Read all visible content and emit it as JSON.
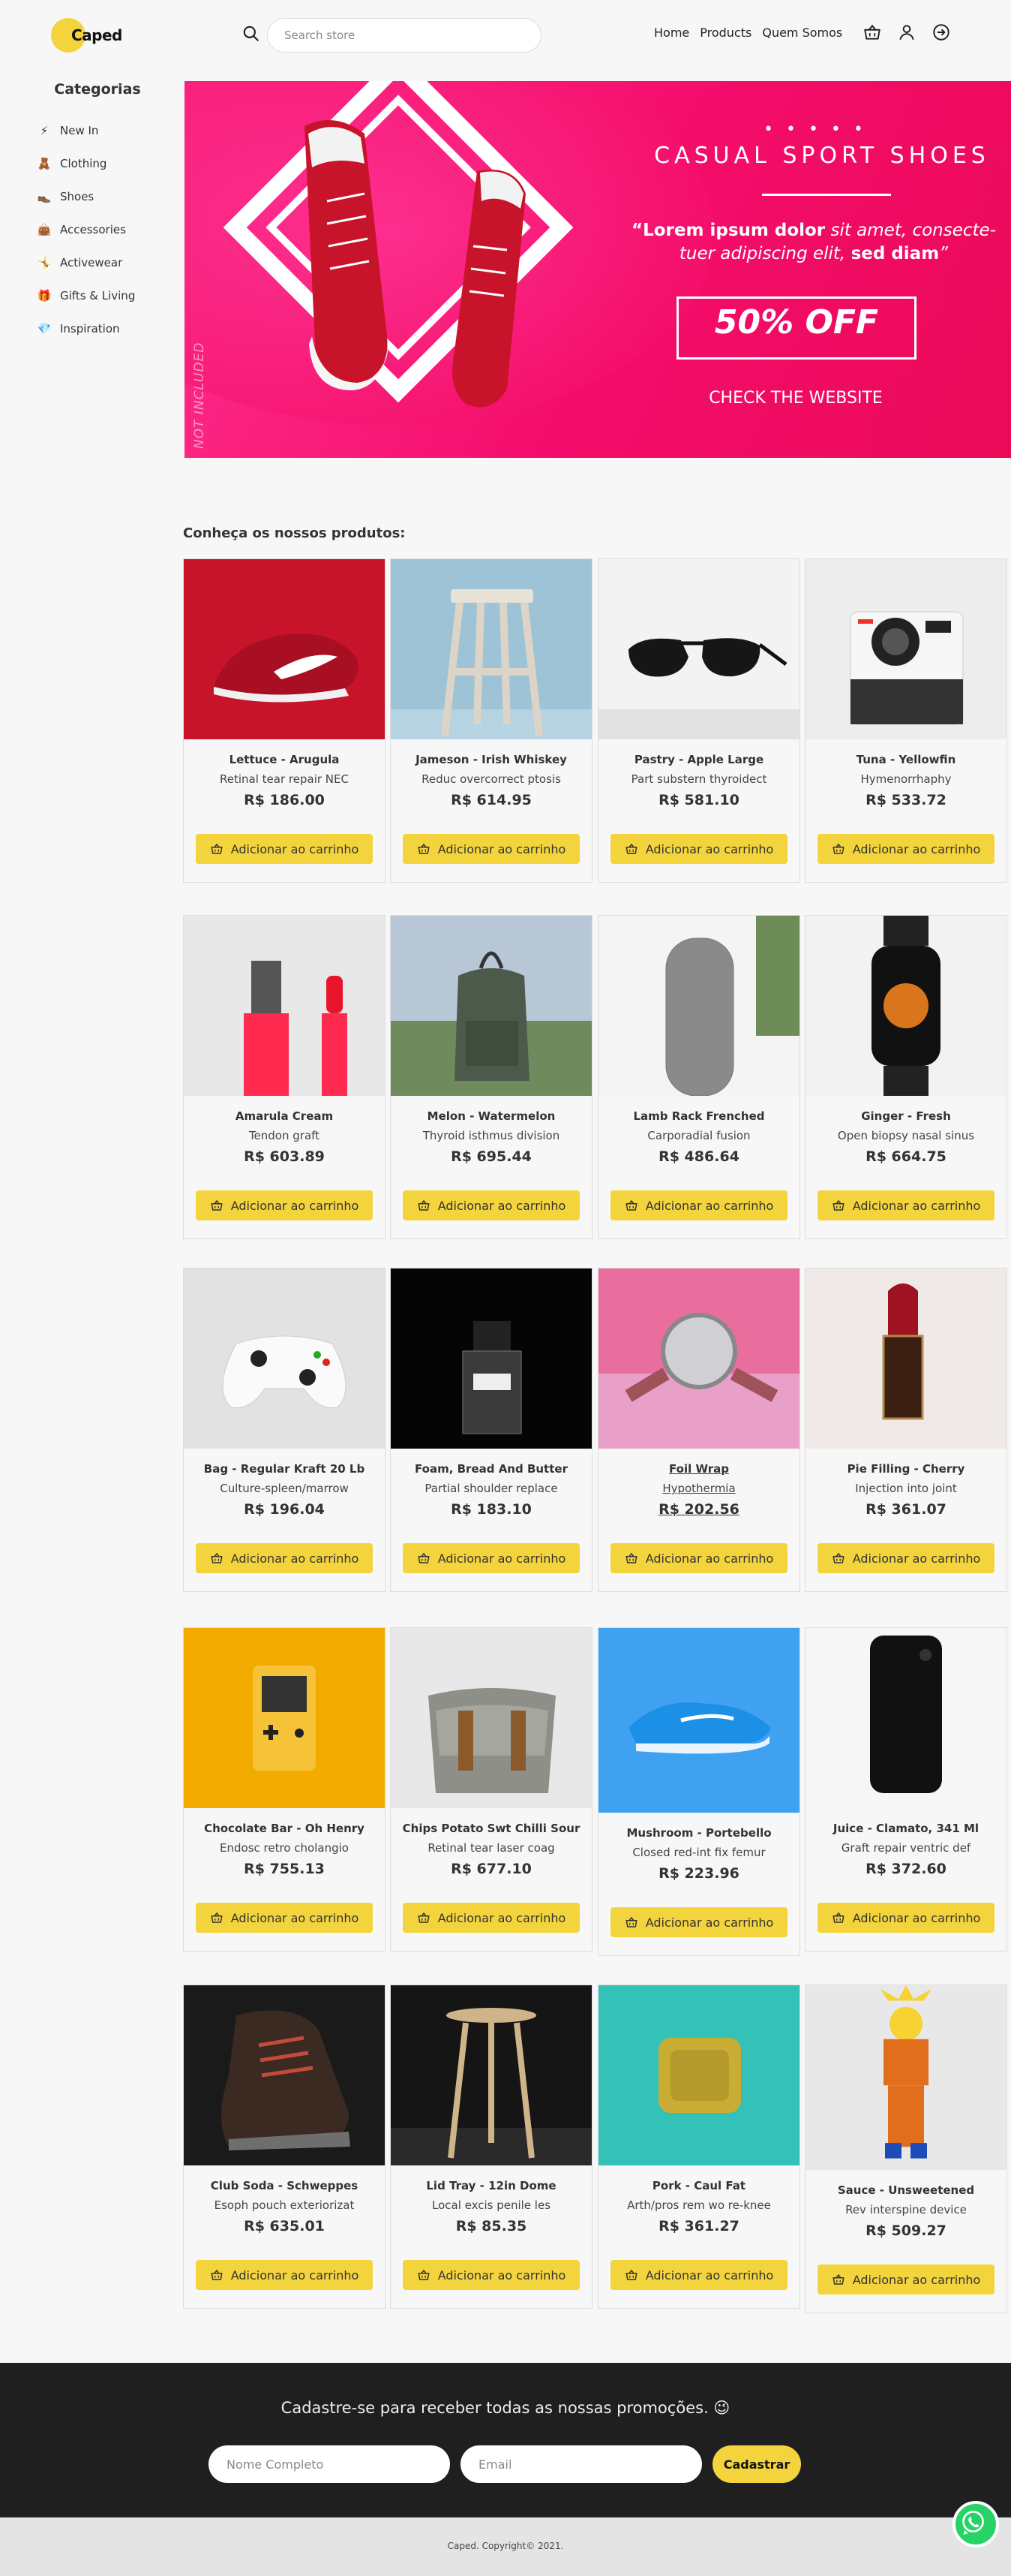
{
  "brand": {
    "name": "Caped"
  },
  "search": {
    "placeholder": "Search store"
  },
  "nav": {
    "items": [
      "Home",
      "Products",
      "Quem Somos"
    ]
  },
  "sidebar": {
    "title": "Categorias",
    "items": [
      {
        "emoji": "⚡",
        "label": "New In"
      },
      {
        "emoji": "🧸",
        "label": "Clothing"
      },
      {
        "emoji": "👞",
        "label": "Shoes"
      },
      {
        "emoji": "👜",
        "label": "Accessories"
      },
      {
        "emoji": "🤸",
        "label": "Activewear"
      },
      {
        "emoji": "🎁",
        "label": "Gifts & Living"
      },
      {
        "emoji": "💎",
        "label": "Inspiration"
      }
    ]
  },
  "banner": {
    "dots": "• • • • •",
    "title": "CASUAL SPORT SHOES",
    "quote_bold1": "“Lorem ipsum dolor",
    "quote_it1": " sit amet, consecte-tuer adipiscing elit, ",
    "quote_bold2": "sed diam",
    "quote_end": "”",
    "offer": "50% OFF",
    "cta": "CHECK THE WEBSITE",
    "side_text": "NOT INCLUDED"
  },
  "products": {
    "title": "Conheça os nossos produtos:",
    "button_label": "Adicionar ao carrinho",
    "items": [
      {
        "name": "Lettuce - Arugula",
        "desc": "Retinal tear repair NEC",
        "price": "R$ 186.00",
        "img": "red-sneaker"
      },
      {
        "name": "Jameson - Irish Whiskey",
        "desc": "Reduc overcorrect ptosis",
        "price": "R$ 614.95",
        "img": "stool"
      },
      {
        "name": "Pastry - Apple Large",
        "desc": "Part substern thyroidect",
        "price": "R$ 581.10",
        "img": "sunglasses"
      },
      {
        "name": "Tuna - Yellowfin",
        "desc": "Hymenorrhaphy",
        "price": "R$ 533.72",
        "img": "polaroid-camera"
      },
      {
        "name": "Amarula Cream",
        "desc": "Tendon graft",
        "price": "R$ 603.89",
        "img": "lipstick-bottle"
      },
      {
        "name": "Melon - Watermelon",
        "desc": "Thyroid isthmus division",
        "price": "R$ 695.44",
        "img": "backpack"
      },
      {
        "name": "Lamb Rack Frenched",
        "desc": "Carporadial fusion",
        "price": "R$ 486.64",
        "img": "smart-speaker"
      },
      {
        "name": "Ginger - Fresh",
        "desc": "Open biopsy nasal sinus",
        "price": "R$ 664.75",
        "img": "smartwatch"
      },
      {
        "name": "Bag - Regular Kraft 20 Lb",
        "desc": "Culture-spleen/marrow",
        "price": "R$ 196.04",
        "img": "game-controller"
      },
      {
        "name": "Foam, Bread And Butter",
        "desc": "Partial shoulder replace",
        "price": "R$ 183.10",
        "img": "perfume"
      },
      {
        "name": "Foil Wrap",
        "desc": "Hypothermia",
        "price": "R$ 202.56",
        "img": "wristwatch"
      },
      {
        "name": "Pie Filling - Cherry",
        "desc": "Injection into joint",
        "price": "R$ 361.07",
        "img": "lipstick"
      },
      {
        "name": "Chocolate Bar - Oh Henry",
        "desc": "Endosc retro cholangio",
        "price": "R$ 755.13",
        "img": "gameboy"
      },
      {
        "name": "Chips Potato Swt Chilli Sour",
        "desc": "Retinal tear laser coag",
        "price": "R$ 677.10",
        "img": "messenger-bag"
      },
      {
        "name": "Mushroom - Portebello",
        "desc": "Closed red-int fix femur",
        "price": "R$ 223.96",
        "img": "blue-sneaker"
      },
      {
        "name": "Juice - Clamato, 341 Ml",
        "desc": "Graft repair ventric def",
        "price": "R$ 372.60",
        "img": "iphone"
      },
      {
        "name": "Club Soda - Schweppes",
        "desc": "Esoph pouch exteriorizat",
        "price": "R$ 635.01",
        "img": "boot"
      },
      {
        "name": "Lid Tray - 12in Dome",
        "desc": "Local excis penile les",
        "price": "R$ 85.35",
        "img": "side-table"
      },
      {
        "name": "Pork - Caul Fat",
        "desc": "Arth/pros rem wo re-knee",
        "price": "R$ 361.27",
        "img": "jbl-speaker"
      },
      {
        "name": "Sauce - Unsweetened",
        "desc": "Rev interspine device",
        "price": "R$ 509.27",
        "img": "goku-figure"
      }
    ]
  },
  "newsletter": {
    "title": "Cadastre-se para receber todas as nossas promoções. 😉",
    "name_placeholder": "Nome Completo",
    "email_placeholder": "Email",
    "button": "Cadastrar"
  },
  "footer": {
    "text": "Caped. Copyright© 2021."
  },
  "colors": {
    "accent": "#f4d43c",
    "banner": "#f40c6a",
    "dark": "#1f1f1f",
    "whatsapp": "#27d366"
  }
}
